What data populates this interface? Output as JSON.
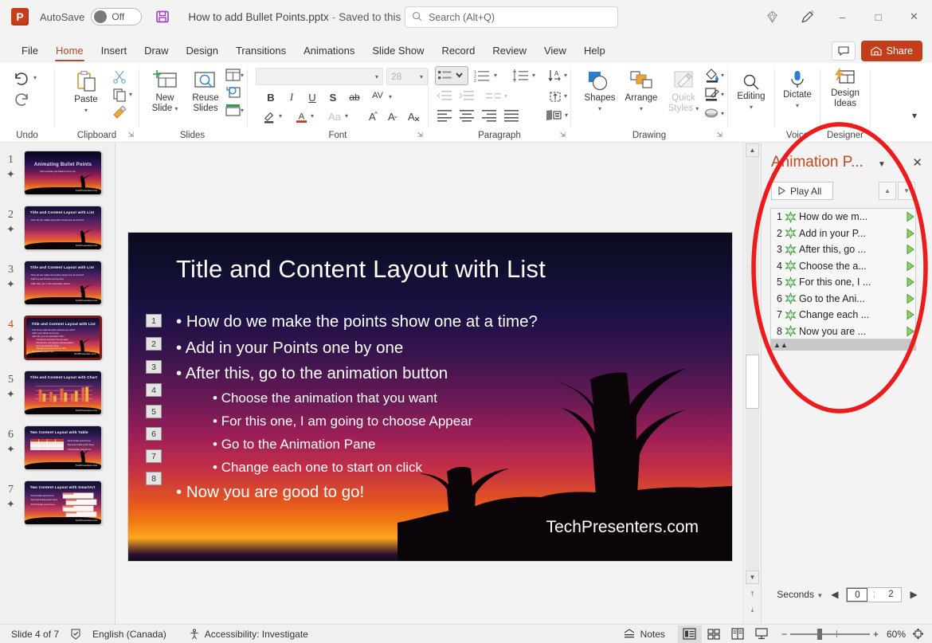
{
  "titlebar": {
    "app_icon": "powerpoint-logo",
    "autosave_label": "AutoSave",
    "autosave_state": "Off",
    "save_icon": "save-icon",
    "document_title": "How to add Bullet Points.pptx",
    "separator": "-",
    "saved_status": "Saved to this PC",
    "search_placeholder": "Search (Alt+Q)",
    "diamond_icon": "diamond-icon",
    "pen_icon": "pen-highlight-icon",
    "minimize": "–",
    "maximize": "□",
    "close": "✕"
  },
  "tabs": [
    {
      "label": "File",
      "active": false
    },
    {
      "label": "Home",
      "active": true
    },
    {
      "label": "Insert",
      "active": false
    },
    {
      "label": "Draw",
      "active": false
    },
    {
      "label": "Design",
      "active": false
    },
    {
      "label": "Transitions",
      "active": false
    },
    {
      "label": "Animations",
      "active": false
    },
    {
      "label": "Slide Show",
      "active": false
    },
    {
      "label": "Record",
      "active": false
    },
    {
      "label": "Review",
      "active": false
    },
    {
      "label": "View",
      "active": false
    },
    {
      "label": "Help",
      "active": false
    }
  ],
  "header_actions": {
    "comments_label": "",
    "share_label": "Share"
  },
  "ribbon": {
    "groups": [
      {
        "name": "Undo",
        "label": "Undo"
      },
      {
        "name": "Clipboard",
        "label": "Clipboard"
      },
      {
        "name": "Slides",
        "label": "Slides"
      },
      {
        "name": "Font",
        "label": "Font"
      },
      {
        "name": "Paragraph",
        "label": "Paragraph"
      },
      {
        "name": "Drawing",
        "label": "Drawing"
      },
      {
        "name": "Editing",
        "label": ""
      },
      {
        "name": "Voice",
        "label": "Voice"
      },
      {
        "name": "Designer",
        "label": "Designer"
      }
    ],
    "undo_label": "Undo",
    "clipboard_label": "Clipboard",
    "paste_label": "Paste",
    "slides_label": "Slides",
    "new_slide_label": "New\nSlide",
    "new_slide_l1": "New",
    "new_slide_l2": "Slide",
    "reuse_slides_l1": "Reuse",
    "reuse_slides_l2": "Slides",
    "font_label": "Font",
    "font_name": "",
    "font_size": "28",
    "bold": "B",
    "italic": "I",
    "underline": "U",
    "shadow": "S",
    "strikethrough": "ab",
    "spacing": "AV",
    "case_label": "Aa",
    "grow_font": "A",
    "shrink_font": "A",
    "clear_format": "A",
    "paragraph_label": "Paragraph",
    "drawing_label": "Drawing",
    "shapes_label": "Shapes",
    "arrange_label": "Arrange",
    "quick_styles_l1": "Quick",
    "quick_styles_l2": "Styles",
    "editing_label": "Editing",
    "voice_label": "Voice",
    "dictate_label": "Dictate",
    "designer_label": "Designer",
    "design_ideas_l1": "Design",
    "design_ideas_l2": "Ideas",
    "collapse_ribbon": "collapse-ribbon-icon"
  },
  "thumbnails": [
    {
      "number": "1",
      "title": "Animating Bullet Points",
      "selected": false,
      "kind": "title",
      "body": [
        "How to animate your bullets in one by one"
      ]
    },
    {
      "number": "2",
      "title": "Title and Content Layout with List",
      "selected": false,
      "kind": "list",
      "body": [
        "How do we make the points show one at a time?"
      ]
    },
    {
      "number": "3",
      "title": "Title and Content Layout with List",
      "selected": false,
      "kind": "list",
      "body": [
        "How do we make the points show one at a time?",
        "Add in your Points one by one",
        "After this, go to the animation button"
      ]
    },
    {
      "number": "4",
      "title": "Title and Content Layout with List",
      "selected": true,
      "kind": "list",
      "body": [
        "How do we make the points show one at a time?",
        "Add in your Points one by one",
        "After this, go to the animation button",
        "Choose the animation that you want",
        "For this one, I am going to choose Appear",
        "Go to the Animation Pane",
        "Change each one to start on click",
        "Now you are good to go!"
      ]
    },
    {
      "number": "5",
      "title": "Title and Content Layout with Chart",
      "selected": false,
      "kind": "chart",
      "body": []
    },
    {
      "number": "6",
      "title": "Two Content Layout with Table",
      "selected": false,
      "kind": "table",
      "body": [
        "First bullet point here",
        "Second bullet point here",
        "Third bullet point here"
      ]
    },
    {
      "number": "7",
      "title": "Two Content Layout with SmartArt",
      "selected": false,
      "kind": "smartart",
      "body": [
        "First bullet point here",
        "Second bullet point here",
        "Third bullet point here"
      ]
    }
  ],
  "slide": {
    "title": "Title and Content Layout with List",
    "footer": "TechPresenters.com",
    "bullets": [
      {
        "tag": "1",
        "level": 1,
        "text": "How do we make the points show one at a time?"
      },
      {
        "tag": "2",
        "level": 1,
        "text": "Add in your Points one by one"
      },
      {
        "tag": "3",
        "level": 1,
        "text": "After this, go to the animation button"
      },
      {
        "tag": "4",
        "level": 2,
        "text": "Choose the animation that you want"
      },
      {
        "tag": "5",
        "level": 2,
        "text": "For this one, I am going to choose Appear"
      },
      {
        "tag": "6",
        "level": 2,
        "text": "Go to the Animation Pane"
      },
      {
        "tag": "7",
        "level": 2,
        "text": "Change each one to start on click"
      },
      {
        "tag": "8",
        "level": 1,
        "text": "Now you are good to go!"
      }
    ]
  },
  "animation_pane": {
    "title": "Animation P...",
    "play_all_label": "Play All",
    "close_icon": "close-icon",
    "dropdown_icon": "chevron-down-icon",
    "move_up_icon": "move-up-icon",
    "move_down_icon": "move-down-icon",
    "collapse_icon": "collapse-chevrons-icon",
    "items": [
      {
        "index": "1",
        "text": "How do we m..."
      },
      {
        "index": "2",
        "text": "Add in your P..."
      },
      {
        "index": "3",
        "text": "After this, go ..."
      },
      {
        "index": "4",
        "text": "Choose the a..."
      },
      {
        "index": "5",
        "text": "For this one, I ..."
      },
      {
        "index": "6",
        "text": "Go to the Ani..."
      },
      {
        "index": "7",
        "text": "Change each ..."
      },
      {
        "index": "8",
        "text": "Now you are ..."
      }
    ],
    "seconds_label": "Seconds",
    "timeline_start": "0",
    "timeline_end": "2",
    "prev_icon": "left-triangle-icon",
    "next_icon": "right-triangle-icon"
  },
  "statusbar": {
    "slide_counter": "Slide 4 of 7",
    "accessibility_checker_icon": "accessibility-check-icon",
    "language": "English (Canada)",
    "accessibility": "Accessibility: Investigate",
    "notes_label": "Notes",
    "views": [
      "normal-view",
      "slide-sorter-view",
      "reading-view",
      "slide-show-view"
    ],
    "zoom_out": "−",
    "zoom_in": "+",
    "zoom_level": "60%",
    "fit_slide_icon": "fit-to-window-icon"
  },
  "annotation": {
    "shape": "red-ellipse-highlight",
    "color": "#ec1c1c"
  }
}
